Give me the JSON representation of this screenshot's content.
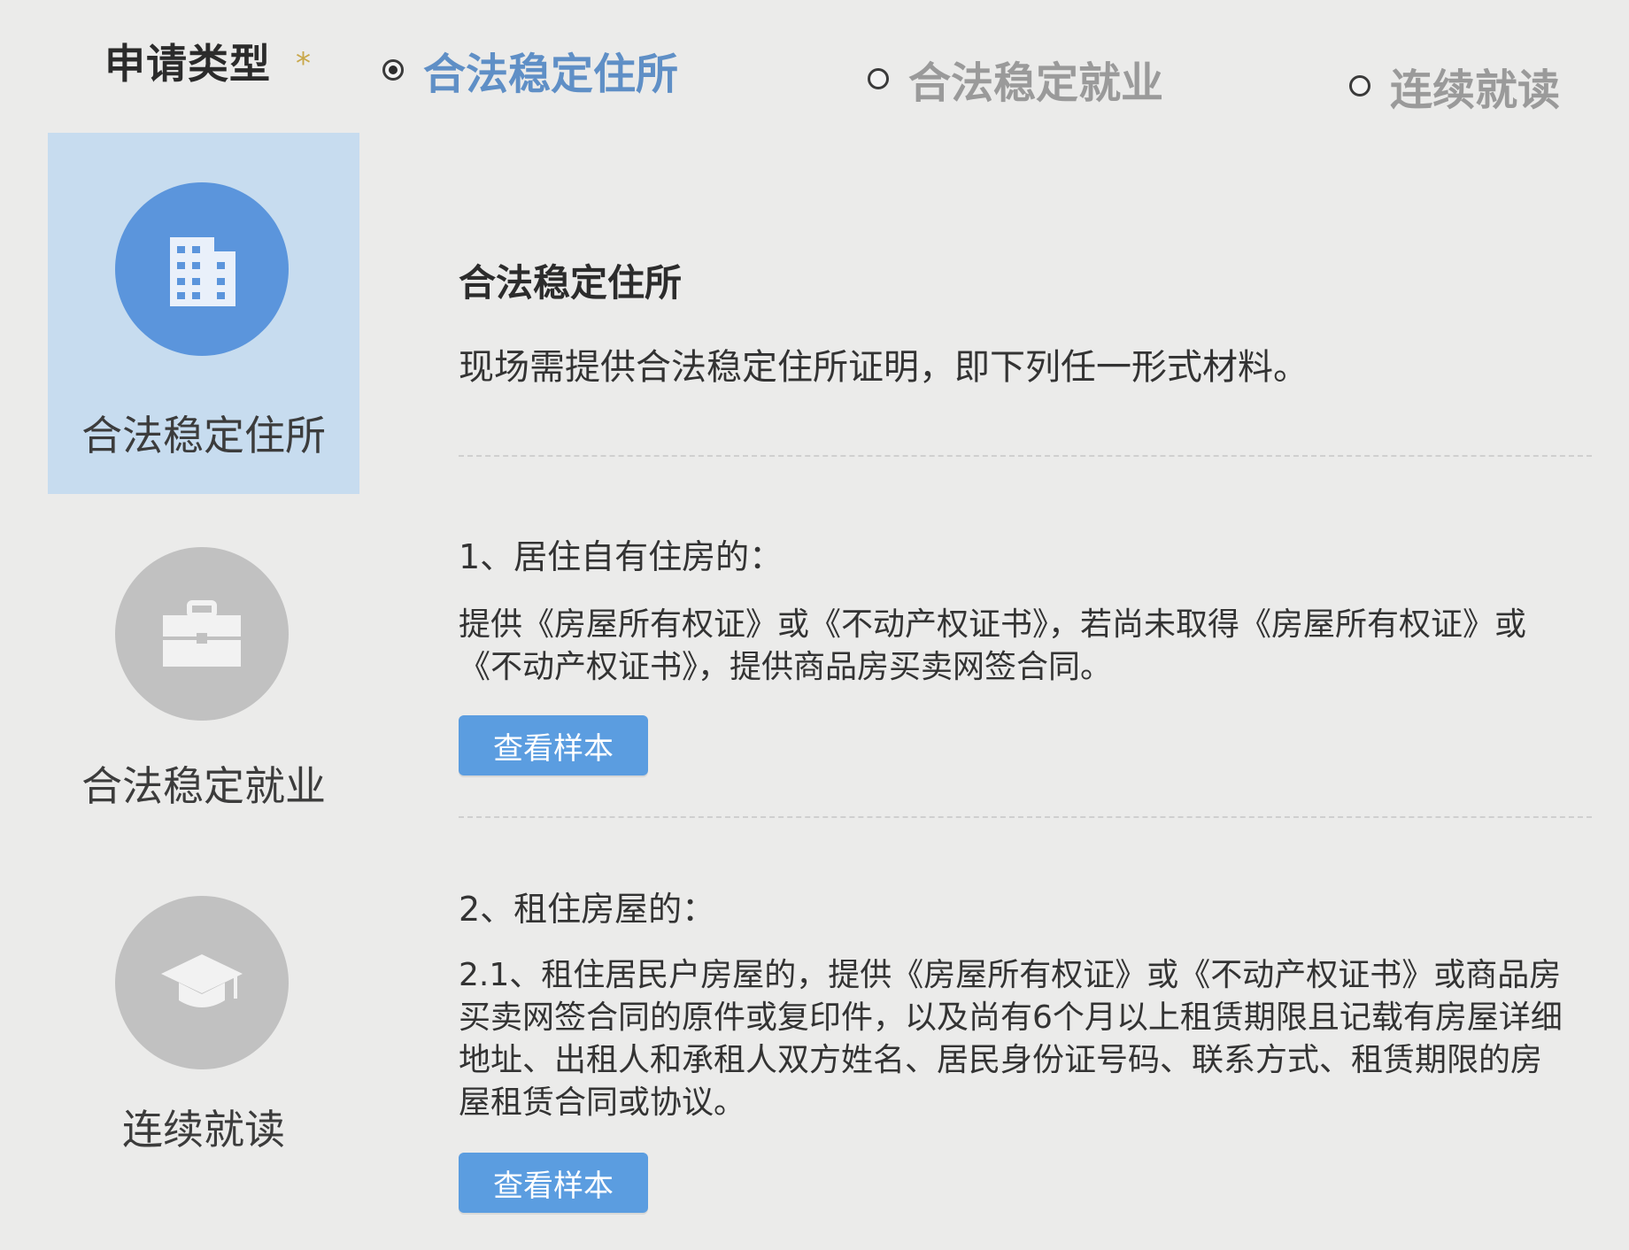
{
  "application_type": {
    "label": "申请类型",
    "required_mark": "*",
    "options": [
      {
        "label": "合法稳定住所",
        "selected": true
      },
      {
        "label": "合法稳定就业",
        "selected": false
      },
      {
        "label": "连续就读",
        "selected": false
      }
    ]
  },
  "side_tabs": [
    {
      "label": "合法稳定住所",
      "icon": "building-icon",
      "active": true
    },
    {
      "label": "合法稳定就业",
      "icon": "briefcase-icon",
      "active": false
    },
    {
      "label": "连续就读",
      "icon": "graduation-cap-icon",
      "active": false
    }
  ],
  "content": {
    "title": "合法稳定住所",
    "intro": "现场需提供合法稳定住所证明，即下列任一形式材料。",
    "items": [
      {
        "heading": "1、居住自有住房的：",
        "body": "提供《房屋所有权证》或《不动产权证书》，若尚未取得《房屋所有权证》或《不动产权证书》，提供商品房买卖网签合同。",
        "button_label": "查看样本"
      },
      {
        "heading": "2、租住房屋的：",
        "body": "2.1、租住居民户房屋的，提供《房屋所有权证》或《不动产权证书》或商品房买卖网签合同的原件或复印件，以及尚有6个月以上租赁期限且记载有房屋详细地址、出租人和承租人双方姓名、居民身份证号码、联系方式、租赁期限的房屋租赁合同或协议。",
        "button_label": "查看样本"
      }
    ]
  },
  "colors": {
    "accent": "#5b95dc",
    "active_tab_bg": "#c7dcef",
    "inactive_icon_bg": "#c1c1c1",
    "selected_radio_text": "#5f8fc6",
    "button_bg": "#5b9de0"
  }
}
